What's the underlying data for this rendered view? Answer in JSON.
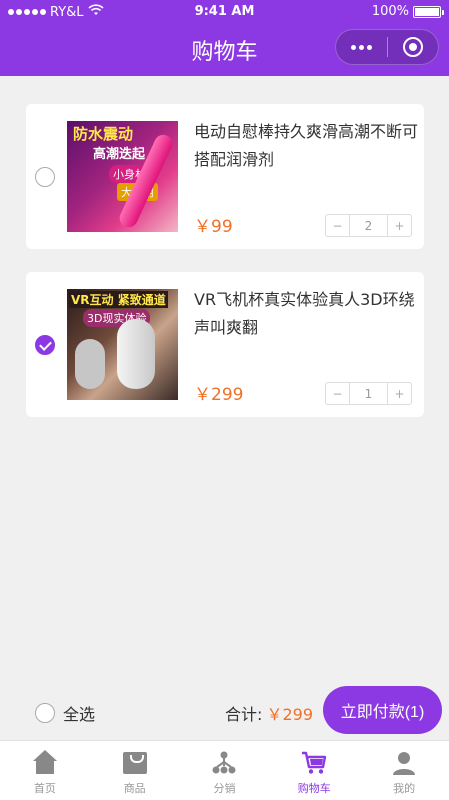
{
  "status": {
    "carrier": "RY&L",
    "time": "9:41 AM",
    "battery": "100%"
  },
  "nav": {
    "title": "购物车"
  },
  "colors": {
    "brand": "#8d39e3",
    "price": "#f07028"
  },
  "cart": {
    "items": [
      {
        "name": "电动自慰棒持久爽滑高潮不断可搭配润滑剂",
        "price": "￥99",
        "qty": "2",
        "checked": false,
        "image_text": [
          "防水震动",
          "高潮迭起",
          "小身材",
          "大作用"
        ]
      },
      {
        "name": "VR飞机杯真实体验真人3D环绕声叫爽翻",
        "price": "￥299",
        "qty": "1",
        "checked": true,
        "image_text": [
          "VR互动 紧致通道",
          "3D现实体验"
        ]
      }
    ],
    "minus": "−",
    "plus": "+"
  },
  "footer": {
    "select_all": "全选",
    "total_label": "合计:",
    "total_amount": "￥299",
    "pay_button": "立即付款(1)"
  },
  "tabbar": [
    {
      "label": "首页",
      "icon": "home-icon"
    },
    {
      "label": "商品",
      "icon": "bag-icon"
    },
    {
      "label": "分销",
      "icon": "share-icon"
    },
    {
      "label": "购物车",
      "icon": "cart-icon",
      "active": true
    },
    {
      "label": "我的",
      "icon": "user-icon"
    }
  ]
}
